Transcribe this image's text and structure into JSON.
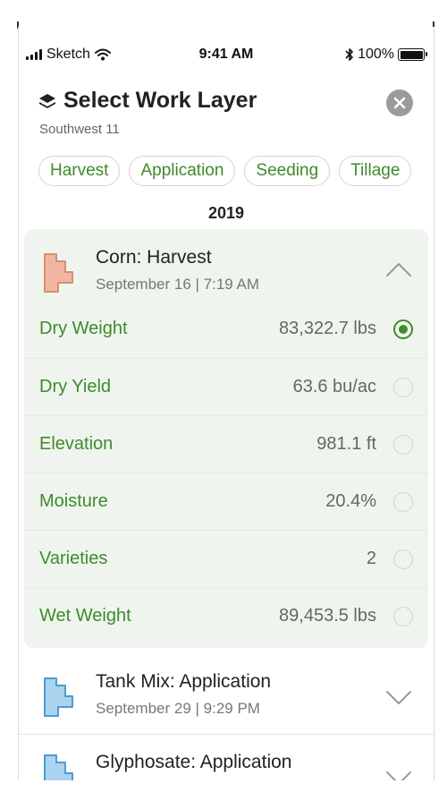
{
  "status_bar": {
    "carrier": "Sketch",
    "time": "9:41 AM",
    "battery_text": "100%",
    "battery_level_pct": 100
  },
  "header": {
    "title": "Select Work Layer",
    "subtitle": "Southwest 11",
    "title_icon": "layers-icon",
    "close_icon": "close-icon"
  },
  "filters": [
    "Harvest",
    "Application",
    "Seeding",
    "Tillage"
  ],
  "year": "2019",
  "layers": [
    {
      "title": "Corn: Harvest",
      "subtitle": "September 16 | 7:19 AM",
      "shape_color": "#f1b6a1",
      "expanded": true,
      "metrics": [
        {
          "label": "Dry Weight",
          "value": "83,322.7 lbs",
          "selected": true
        },
        {
          "label": "Dry Yield",
          "value": "63.6 bu/ac",
          "selected": false
        },
        {
          "label": "Elevation",
          "value": "981.1 ft",
          "selected": false
        },
        {
          "label": "Moisture",
          "value": "20.4%",
          "selected": false
        },
        {
          "label": "Varieties",
          "value": "2",
          "selected": false
        },
        {
          "label": "Wet Weight",
          "value": "89,453.5 lbs",
          "selected": false
        }
      ]
    },
    {
      "title": "Tank Mix: Application",
      "subtitle": "September 29  | 9:29 PM",
      "shape_color": "#a9d3ef",
      "expanded": false
    },
    {
      "title": "Glyphosate: Application",
      "subtitle": "",
      "shape_color": "#a9d3ef",
      "expanded": false
    }
  ],
  "colors": {
    "accent_green": "#3f8a2c",
    "card_background": "#eff5ee",
    "close_button": "#9b9b9b"
  }
}
